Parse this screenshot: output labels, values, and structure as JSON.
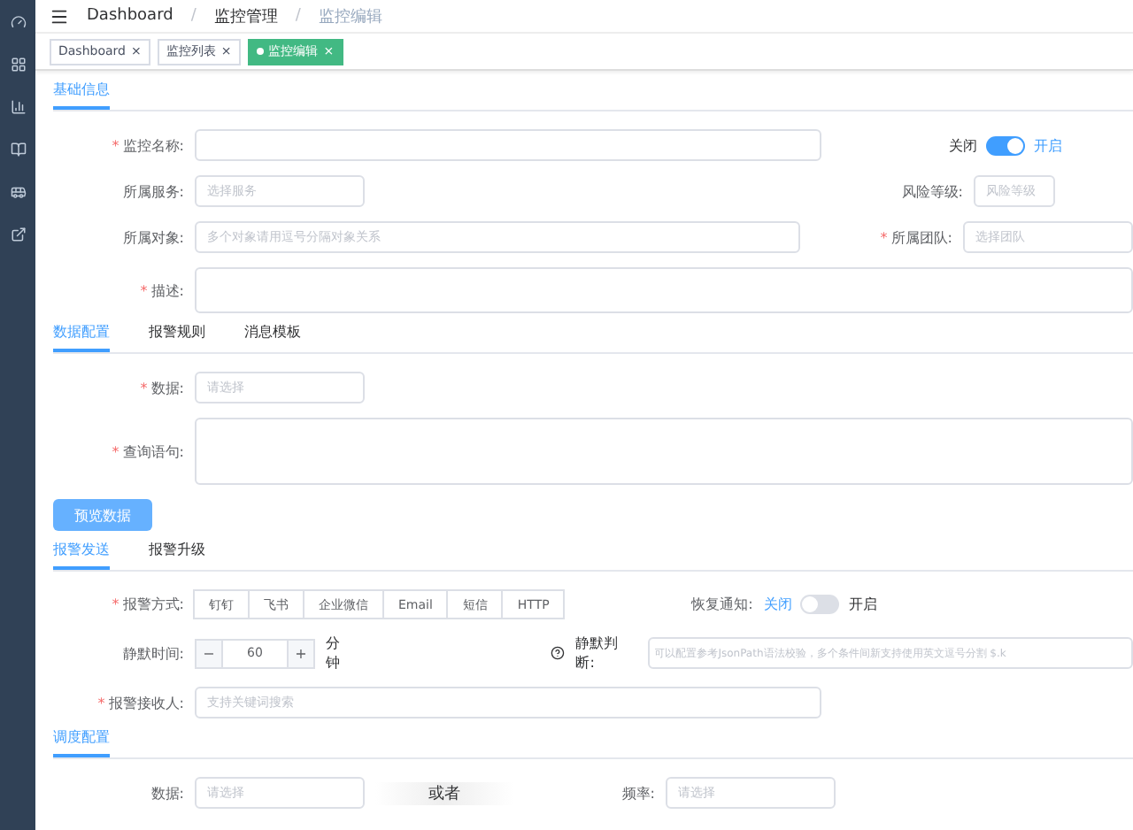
{
  "breadcrumb": [
    "Dashboard",
    "监控管理",
    "监控编辑"
  ],
  "breadcrumb_separator": "/",
  "tags": [
    {
      "label": "Dashboard",
      "close": "×",
      "selected": false
    },
    {
      "label": "监控列表",
      "close": "×",
      "selected": false
    },
    {
      "label": "监控编辑",
      "close": "×",
      "selected": true
    }
  ],
  "required_mark": "*",
  "basic": {
    "tab": "基础信息",
    "name": {
      "label": "监控名称:",
      "required": true
    },
    "enabled": {
      "off_label": "关闭",
      "on_label": "开启",
      "on": true
    },
    "service": {
      "label": "所属服务:",
      "placeholder": "选择服务"
    },
    "risk": {
      "label": "风险等级:",
      "placeholder": "风险等级"
    },
    "object": {
      "label": "所属对象:",
      "placeholder": "多个对象请用逗号分隔对象关系"
    },
    "team": {
      "label": "所属团队:",
      "placeholder": "选择团队",
      "required": true
    },
    "desc": {
      "label": "描述:",
      "required": true
    }
  },
  "config_tabs": [
    {
      "label": "数据配置",
      "selected": true
    },
    {
      "label": "报警规则",
      "selected": false
    },
    {
      "label": "消息模板",
      "selected": false
    }
  ],
  "data": {
    "label": "数据:",
    "placeholder": "请选择",
    "required": true
  },
  "query": {
    "label": "查询语句:",
    "required": true
  },
  "preview_button": "预览数据",
  "alert_tabs": [
    {
      "label": "报警发送",
      "selected": true
    },
    {
      "label": "报警升级",
      "selected": false
    }
  ],
  "methods": {
    "label": "报警方式:",
    "required": true,
    "options": [
      "钉钉",
      "飞书",
      "企业微信",
      "Email",
      "短信",
      "HTTP"
    ]
  },
  "recover": {
    "label": "恢复通知:",
    "off_label": "关闭",
    "on_label": "开启",
    "on": false
  },
  "silence": {
    "label": "静默时间:",
    "minus": "−",
    "value": "60",
    "plus": "+",
    "unit": "分钟"
  },
  "silence_judge": {
    "label": "静默判断:",
    "placeholder": "可以配置参考JsonPath语法校验，多个条件间新支持使用英文逗号分割 $.k"
  },
  "receiver": {
    "label": "报警接收人:",
    "placeholder": "支持关键词搜索",
    "required": true
  },
  "schedule": {
    "tab": "调度配置",
    "data": {
      "label": "数据:",
      "placeholder": "请选择"
    },
    "overlay": "或者",
    "freq": {
      "label": "频率:",
      "placeholder": "请选择"
    }
  }
}
